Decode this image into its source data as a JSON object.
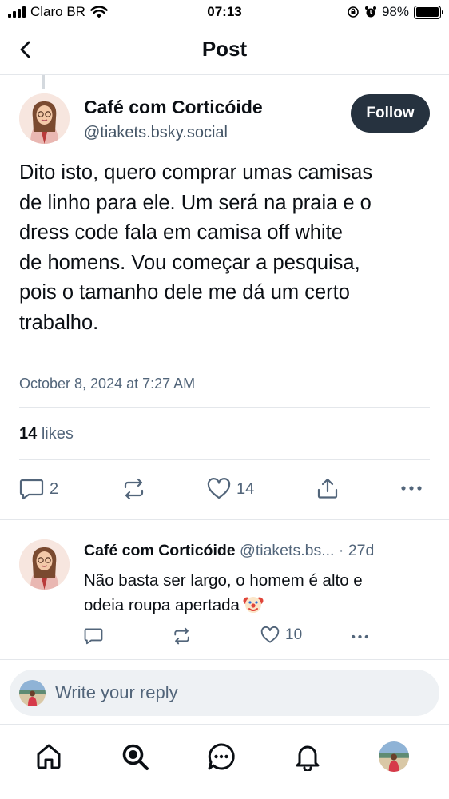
{
  "status_bar": {
    "carrier": "Claro BR",
    "time": "07:13",
    "battery": "98%",
    "battery_level": 0.98,
    "icons": [
      "signal-icon",
      "wifi-icon",
      "orientation-lock-icon",
      "alarm-icon",
      "battery-icon"
    ]
  },
  "header": {
    "title": "Post",
    "back_icon": "chevron-left-icon"
  },
  "post": {
    "author_name": "Café com Corticóide",
    "author_handle": "@tiakets.bsky.social",
    "follow_label": "Follow",
    "text_lines": [
      "Dito isto, quero comprar umas camisas",
      "de linho para ele. Um será na praia e o",
      "dress code fala em camisa off white",
      "de homens. Vou começar a pesquisa,",
      "pois o tamanho dele me dá um certo",
      "trabalho."
    ],
    "date": "October 8, 2024 at 7:27 AM",
    "likes_count": "14",
    "likes_label": "likes",
    "actions": {
      "reply_count": "2",
      "repost_count": "",
      "like_count": "14"
    }
  },
  "reply": {
    "author_name": "Café com Corticóide",
    "author_handle": "@tiakets.bs...",
    "time": "· 27d",
    "text_lines": [
      "Não basta ser largo, o homem é alto e",
      "odeia roupa apertada"
    ],
    "emoji": "clown-face-emoji",
    "actions": {
      "like_count": "10"
    }
  },
  "composer": {
    "placeholder": "Write your reply"
  },
  "bottom_nav": {
    "items": [
      "home-icon",
      "search-icon",
      "chat-icon",
      "notifications-icon",
      "profile-avatar"
    ]
  },
  "colors": {
    "accent_dark": "#26323f",
    "muted_text": "#52657a",
    "divider": "#e4e7eb",
    "composer_bg": "#eef1f4"
  }
}
